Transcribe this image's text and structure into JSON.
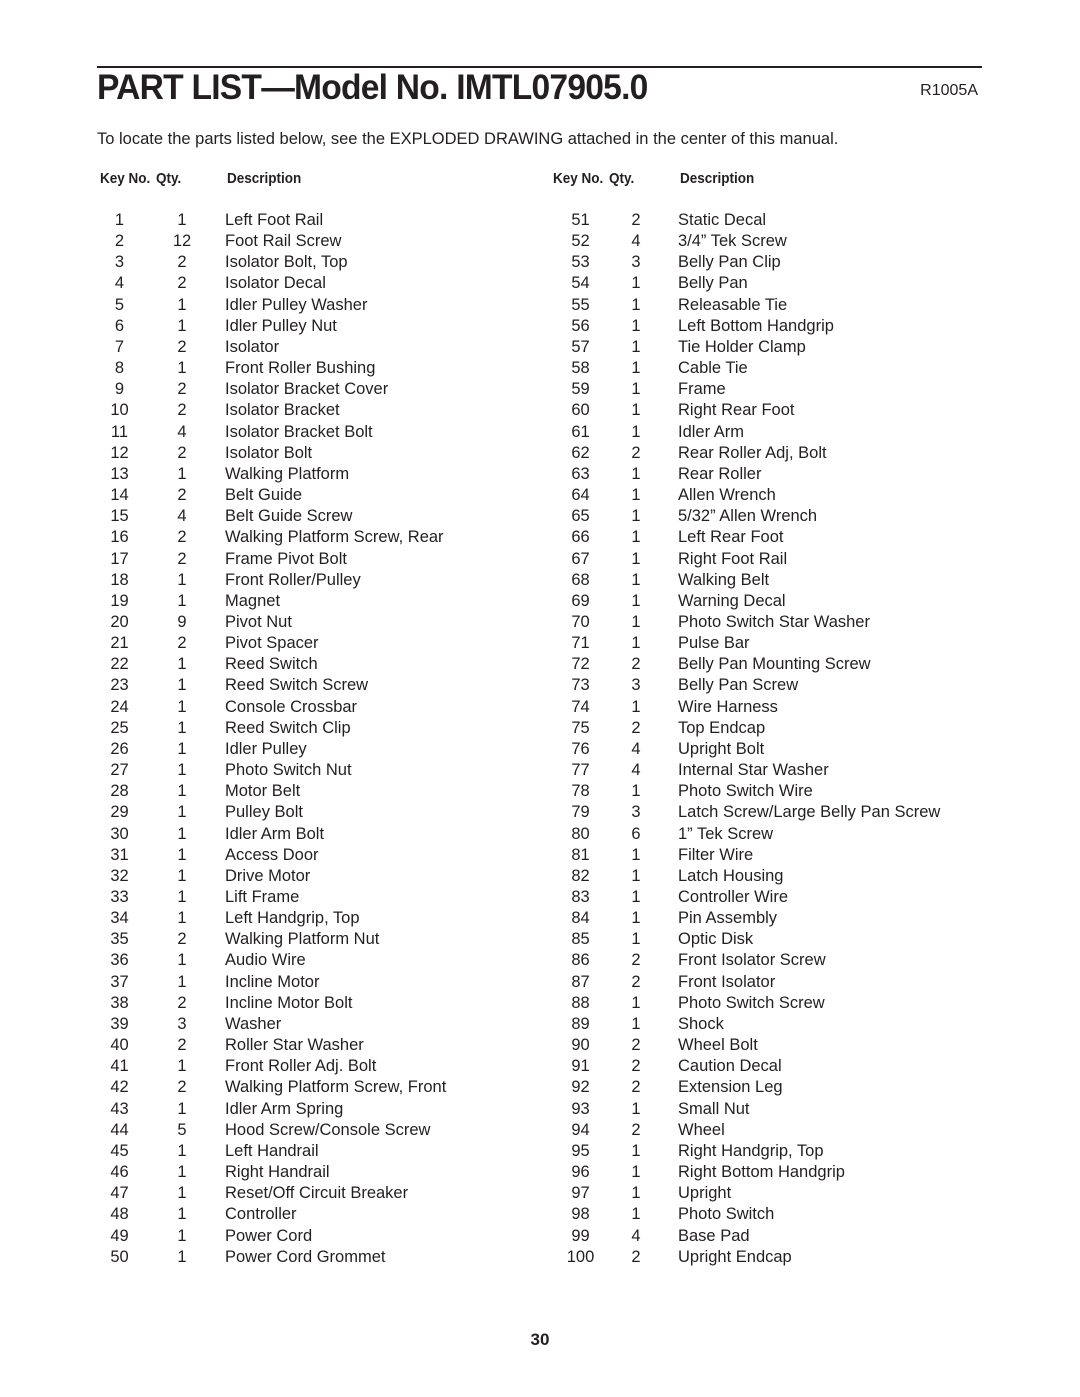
{
  "header": {
    "title": "PART LIST—Model No. IMTL07905.0",
    "doc_code": "R1005A"
  },
  "intro": "To locate the parts listed below, see the EXPLODED DRAWING attached in the center of this manual.",
  "columns": {
    "key": "Key No.",
    "qty": "Qty.",
    "desc": "Description"
  },
  "parts": [
    {
      "key": "1",
      "qty": "1",
      "desc": "Left Foot Rail"
    },
    {
      "key": "2",
      "qty": "12",
      "desc": "Foot Rail Screw"
    },
    {
      "key": "3",
      "qty": "2",
      "desc": "Isolator Bolt, Top"
    },
    {
      "key": "4",
      "qty": "2",
      "desc": "Isolator Decal"
    },
    {
      "key": "5",
      "qty": "1",
      "desc": "Idler Pulley Washer"
    },
    {
      "key": "6",
      "qty": "1",
      "desc": "Idler Pulley Nut"
    },
    {
      "key": "7",
      "qty": "2",
      "desc": "Isolator"
    },
    {
      "key": "8",
      "qty": "1",
      "desc": "Front Roller Bushing"
    },
    {
      "key": "9",
      "qty": "2",
      "desc": "Isolator Bracket Cover"
    },
    {
      "key": "10",
      "qty": "2",
      "desc": "Isolator Bracket"
    },
    {
      "key": "11",
      "qty": "4",
      "desc": "Isolator Bracket Bolt"
    },
    {
      "key": "12",
      "qty": "2",
      "desc": "Isolator Bolt"
    },
    {
      "key": "13",
      "qty": "1",
      "desc": "Walking Platform"
    },
    {
      "key": "14",
      "qty": "2",
      "desc": "Belt Guide"
    },
    {
      "key": "15",
      "qty": "4",
      "desc": "Belt Guide Screw"
    },
    {
      "key": "16",
      "qty": "2",
      "desc": "Walking Platform Screw, Rear"
    },
    {
      "key": "17",
      "qty": "2",
      "desc": "Frame Pivot Bolt"
    },
    {
      "key": "18",
      "qty": "1",
      "desc": "Front Roller/Pulley"
    },
    {
      "key": "19",
      "qty": "1",
      "desc": "Magnet"
    },
    {
      "key": "20",
      "qty": "9",
      "desc": "Pivot Nut"
    },
    {
      "key": "21",
      "qty": "2",
      "desc": "Pivot Spacer"
    },
    {
      "key": "22",
      "qty": "1",
      "desc": "Reed Switch"
    },
    {
      "key": "23",
      "qty": "1",
      "desc": "Reed Switch Screw"
    },
    {
      "key": "24",
      "qty": "1",
      "desc": "Console Crossbar"
    },
    {
      "key": "25",
      "qty": "1",
      "desc": "Reed Switch Clip"
    },
    {
      "key": "26",
      "qty": "1",
      "desc": "Idler Pulley"
    },
    {
      "key": "27",
      "qty": "1",
      "desc": "Photo Switch Nut"
    },
    {
      "key": "28",
      "qty": "1",
      "desc": "Motor Belt"
    },
    {
      "key": "29",
      "qty": "1",
      "desc": "Pulley Bolt"
    },
    {
      "key": "30",
      "qty": "1",
      "desc": "Idler Arm Bolt"
    },
    {
      "key": "31",
      "qty": "1",
      "desc": "Access Door"
    },
    {
      "key": "32",
      "qty": "1",
      "desc": "Drive Motor"
    },
    {
      "key": "33",
      "qty": "1",
      "desc": "Lift Frame"
    },
    {
      "key": "34",
      "qty": "1",
      "desc": "Left Handgrip, Top"
    },
    {
      "key": "35",
      "qty": "2",
      "desc": "Walking Platform Nut"
    },
    {
      "key": "36",
      "qty": "1",
      "desc": "Audio Wire"
    },
    {
      "key": "37",
      "qty": "1",
      "desc": "Incline Motor"
    },
    {
      "key": "38",
      "qty": "2",
      "desc": "Incline Motor Bolt"
    },
    {
      "key": "39",
      "qty": "3",
      "desc": "Washer"
    },
    {
      "key": "40",
      "qty": "2",
      "desc": "Roller Star Washer"
    },
    {
      "key": "41",
      "qty": "1",
      "desc": "Front Roller Adj. Bolt"
    },
    {
      "key": "42",
      "qty": "2",
      "desc": "Walking Platform Screw, Front"
    },
    {
      "key": "43",
      "qty": "1",
      "desc": "Idler Arm Spring"
    },
    {
      "key": "44",
      "qty": "5",
      "desc": "Hood Screw/Console Screw"
    },
    {
      "key": "45",
      "qty": "1",
      "desc": "Left Handrail"
    },
    {
      "key": "46",
      "qty": "1",
      "desc": "Right Handrail"
    },
    {
      "key": "47",
      "qty": "1",
      "desc": "Reset/Off Circuit Breaker"
    },
    {
      "key": "48",
      "qty": "1",
      "desc": "Controller"
    },
    {
      "key": "49",
      "qty": "1",
      "desc": "Power Cord"
    },
    {
      "key": "50",
      "qty": "1",
      "desc": "Power Cord Grommet"
    },
    {
      "key": "51",
      "qty": "2",
      "desc": "Static Decal"
    },
    {
      "key": "52",
      "qty": "4",
      "desc": "3/4” Tek Screw"
    },
    {
      "key": "53",
      "qty": "3",
      "desc": "Belly Pan Clip"
    },
    {
      "key": "54",
      "qty": "1",
      "desc": "Belly Pan"
    },
    {
      "key": "55",
      "qty": "1",
      "desc": "Releasable Tie"
    },
    {
      "key": "56",
      "qty": "1",
      "desc": "Left Bottom Handgrip"
    },
    {
      "key": "57",
      "qty": "1",
      "desc": "Tie Holder Clamp"
    },
    {
      "key": "58",
      "qty": "1",
      "desc": "Cable Tie"
    },
    {
      "key": "59",
      "qty": "1",
      "desc": "Frame"
    },
    {
      "key": "60",
      "qty": "1",
      "desc": "Right Rear Foot"
    },
    {
      "key": "61",
      "qty": "1",
      "desc": "Idler Arm"
    },
    {
      "key": "62",
      "qty": "2",
      "desc": "Rear Roller Adj, Bolt"
    },
    {
      "key": "63",
      "qty": "1",
      "desc": "Rear Roller"
    },
    {
      "key": "64",
      "qty": "1",
      "desc": "Allen Wrench"
    },
    {
      "key": "65",
      "qty": "1",
      "desc": "5/32” Allen Wrench"
    },
    {
      "key": "66",
      "qty": "1",
      "desc": "Left Rear Foot"
    },
    {
      "key": "67",
      "qty": "1",
      "desc": "Right Foot Rail"
    },
    {
      "key": "68",
      "qty": "1",
      "desc": "Walking Belt"
    },
    {
      "key": "69",
      "qty": "1",
      "desc": "Warning Decal"
    },
    {
      "key": "70",
      "qty": "1",
      "desc": "Photo Switch Star Washer"
    },
    {
      "key": "71",
      "qty": "1",
      "desc": "Pulse Bar"
    },
    {
      "key": "72",
      "qty": "2",
      "desc": "Belly Pan Mounting Screw"
    },
    {
      "key": "73",
      "qty": "3",
      "desc": "Belly Pan Screw"
    },
    {
      "key": "74",
      "qty": "1",
      "desc": "Wire Harness"
    },
    {
      "key": "75",
      "qty": "2",
      "desc": "Top Endcap"
    },
    {
      "key": "76",
      "qty": "4",
      "desc": "Upright Bolt"
    },
    {
      "key": "77",
      "qty": "4",
      "desc": "Internal Star Washer"
    },
    {
      "key": "78",
      "qty": "1",
      "desc": "Photo Switch Wire"
    },
    {
      "key": "79",
      "qty": "3",
      "desc": "Latch Screw/Large Belly Pan Screw"
    },
    {
      "key": "80",
      "qty": "6",
      "desc": "1” Tek Screw"
    },
    {
      "key": "81",
      "qty": "1",
      "desc": "Filter Wire"
    },
    {
      "key": "82",
      "qty": "1",
      "desc": "Latch Housing"
    },
    {
      "key": "83",
      "qty": "1",
      "desc": "Controller Wire"
    },
    {
      "key": "84",
      "qty": "1",
      "desc": "Pin Assembly"
    },
    {
      "key": "85",
      "qty": "1",
      "desc": "Optic Disk"
    },
    {
      "key": "86",
      "qty": "2",
      "desc": "Front Isolator Screw"
    },
    {
      "key": "87",
      "qty": "2",
      "desc": "Front Isolator"
    },
    {
      "key": "88",
      "qty": "1",
      "desc": "Photo Switch Screw"
    },
    {
      "key": "89",
      "qty": "1",
      "desc": "Shock"
    },
    {
      "key": "90",
      "qty": "2",
      "desc": "Wheel Bolt"
    },
    {
      "key": "91",
      "qty": "2",
      "desc": "Caution Decal"
    },
    {
      "key": "92",
      "qty": "2",
      "desc": "Extension Leg"
    },
    {
      "key": "93",
      "qty": "1",
      "desc": "Small Nut"
    },
    {
      "key": "94",
      "qty": "2",
      "desc": "Wheel"
    },
    {
      "key": "95",
      "qty": "1",
      "desc": "Right Handgrip, Top"
    },
    {
      "key": "96",
      "qty": "1",
      "desc": "Right Bottom Handgrip"
    },
    {
      "key": "97",
      "qty": "1",
      "desc": "Upright"
    },
    {
      "key": "98",
      "qty": "1",
      "desc": "Photo Switch"
    },
    {
      "key": "99",
      "qty": "4",
      "desc": "Base Pad"
    },
    {
      "key": "100",
      "qty": "2",
      "desc": "Upright Endcap"
    }
  ],
  "page_number": "30"
}
